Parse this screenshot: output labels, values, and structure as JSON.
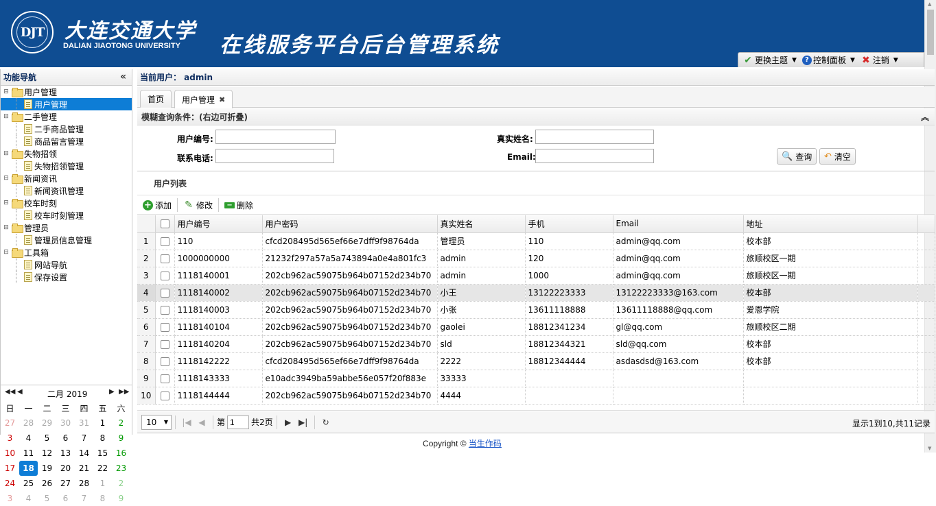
{
  "header": {
    "logo_text": "DJT",
    "university_cn": "大连交通大学",
    "university_en": "DALIAN JIAOTONG UNIVERSITY",
    "system_title": "在线服务平台后台管理系统",
    "tools": [
      {
        "label": "更换主题",
        "icon": "check-icon",
        "color": "#3a9a3a"
      },
      {
        "label": "控制面板",
        "icon": "help-icon",
        "color": "#1f5fbf"
      },
      {
        "label": "注销",
        "icon": "close-icon",
        "color": "#d62a2a"
      }
    ]
  },
  "nav": {
    "title": "功能导航",
    "groups": [
      {
        "label": "用户管理",
        "children": [
          "用户管理"
        ]
      },
      {
        "label": "二手管理",
        "children": [
          "二手商品管理",
          "商品留言管理"
        ]
      },
      {
        "label": "失物招领",
        "children": [
          "失物招领管理"
        ]
      },
      {
        "label": "新闻资讯",
        "children": [
          "新闻资讯管理"
        ]
      },
      {
        "label": "校车时刻",
        "children": [
          "校车时刻管理"
        ]
      },
      {
        "label": "管理员",
        "children": [
          "管理员信息管理"
        ]
      },
      {
        "label": "工具箱",
        "children": [
          "网站导航",
          "保存设置"
        ]
      }
    ],
    "selected": "用户管理"
  },
  "calendar": {
    "title": "二月 2019",
    "weekdays": [
      "日",
      "一",
      "二",
      "三",
      "四",
      "五",
      "六"
    ],
    "weeks": [
      [
        "27",
        "28",
        "29",
        "30",
        "31",
        "1",
        "2"
      ],
      [
        "3",
        "4",
        "5",
        "6",
        "7",
        "8",
        "9"
      ],
      [
        "10",
        "11",
        "12",
        "13",
        "14",
        "15",
        "16"
      ],
      [
        "17",
        "18",
        "19",
        "20",
        "21",
        "22",
        "23"
      ],
      [
        "24",
        "25",
        "26",
        "27",
        "28",
        "1",
        "2"
      ],
      [
        "3",
        "4",
        "5",
        "6",
        "7",
        "8",
        "9"
      ]
    ],
    "today": "18"
  },
  "main": {
    "current_user_label": "当前用户： admin",
    "tabs": [
      {
        "label": "首页"
      },
      {
        "label": "用户管理"
      }
    ],
    "search": {
      "title": "模糊查询条件：(右边可折叠)",
      "user_id_label": "用户编号:",
      "real_name_label": "真实姓名:",
      "phone_label": "联系电话:",
      "email_label": "Email:",
      "query_button": "查询",
      "clear_button": "清空"
    },
    "list_title": "用户列表",
    "toolbar": {
      "add": "添加",
      "edit": "修改",
      "delete": "删除"
    },
    "columns": [
      "用户编号",
      "用户密码",
      "真实姓名",
      "手机",
      "Email",
      "地址"
    ],
    "rows": [
      [
        "1",
        "110",
        "cfcd208495d565ef66e7dff9f98764da",
        "管理员",
        "110",
        "admin@qq.com",
        "校本部"
      ],
      [
        "2",
        "1000000000",
        "21232f297a57a5a743894a0e4a801fc3",
        "admin",
        "120",
        "admin@qq.com",
        "旅顺校区一期"
      ],
      [
        "3",
        "1118140001",
        "202cb962ac59075b964b07152d234b70",
        "admin",
        "1000",
        "admin@qq.com",
        "旅顺校区一期"
      ],
      [
        "4",
        "1118140002",
        "202cb962ac59075b964b07152d234b70",
        "小王",
        "13122223333",
        "13122223333@163.com",
        "校本部"
      ],
      [
        "5",
        "1118140003",
        "202cb962ac59075b964b07152d234b70",
        "小张",
        "13611118888",
        "13611118888@qq.com",
        "爱恩学院"
      ],
      [
        "6",
        "1118140104",
        "202cb962ac59075b964b07152d234b70",
        "gaolei",
        "18812341234",
        "gl@qq.com",
        "旅顺校区二期"
      ],
      [
        "7",
        "1118140204",
        "202cb962ac59075b964b07152d234b70",
        "sld",
        "18812344321",
        "sld@qq.com",
        "校本部"
      ],
      [
        "8",
        "1118142222",
        "cfcd208495d565ef66e7dff9f98764da",
        "2222",
        "18812344444",
        "asdasdsd@163.com",
        "校本部"
      ],
      [
        "9",
        "1118143333",
        "e10adc3949ba59abbe56e057f20f883e",
        "33333",
        "",
        "",
        ""
      ],
      [
        "10",
        "1118144444",
        "202cb962ac59075b964b07152d234b70",
        "4444",
        "",
        "",
        ""
      ]
    ],
    "hover_row": "4",
    "pager": {
      "page_size": "10",
      "page_prefix": "第",
      "page_value": "1",
      "page_suffix": "共2页",
      "info": "显示1到10,共11记录"
    }
  },
  "footer": {
    "text": "Copyright © ",
    "link": "当生作码"
  }
}
